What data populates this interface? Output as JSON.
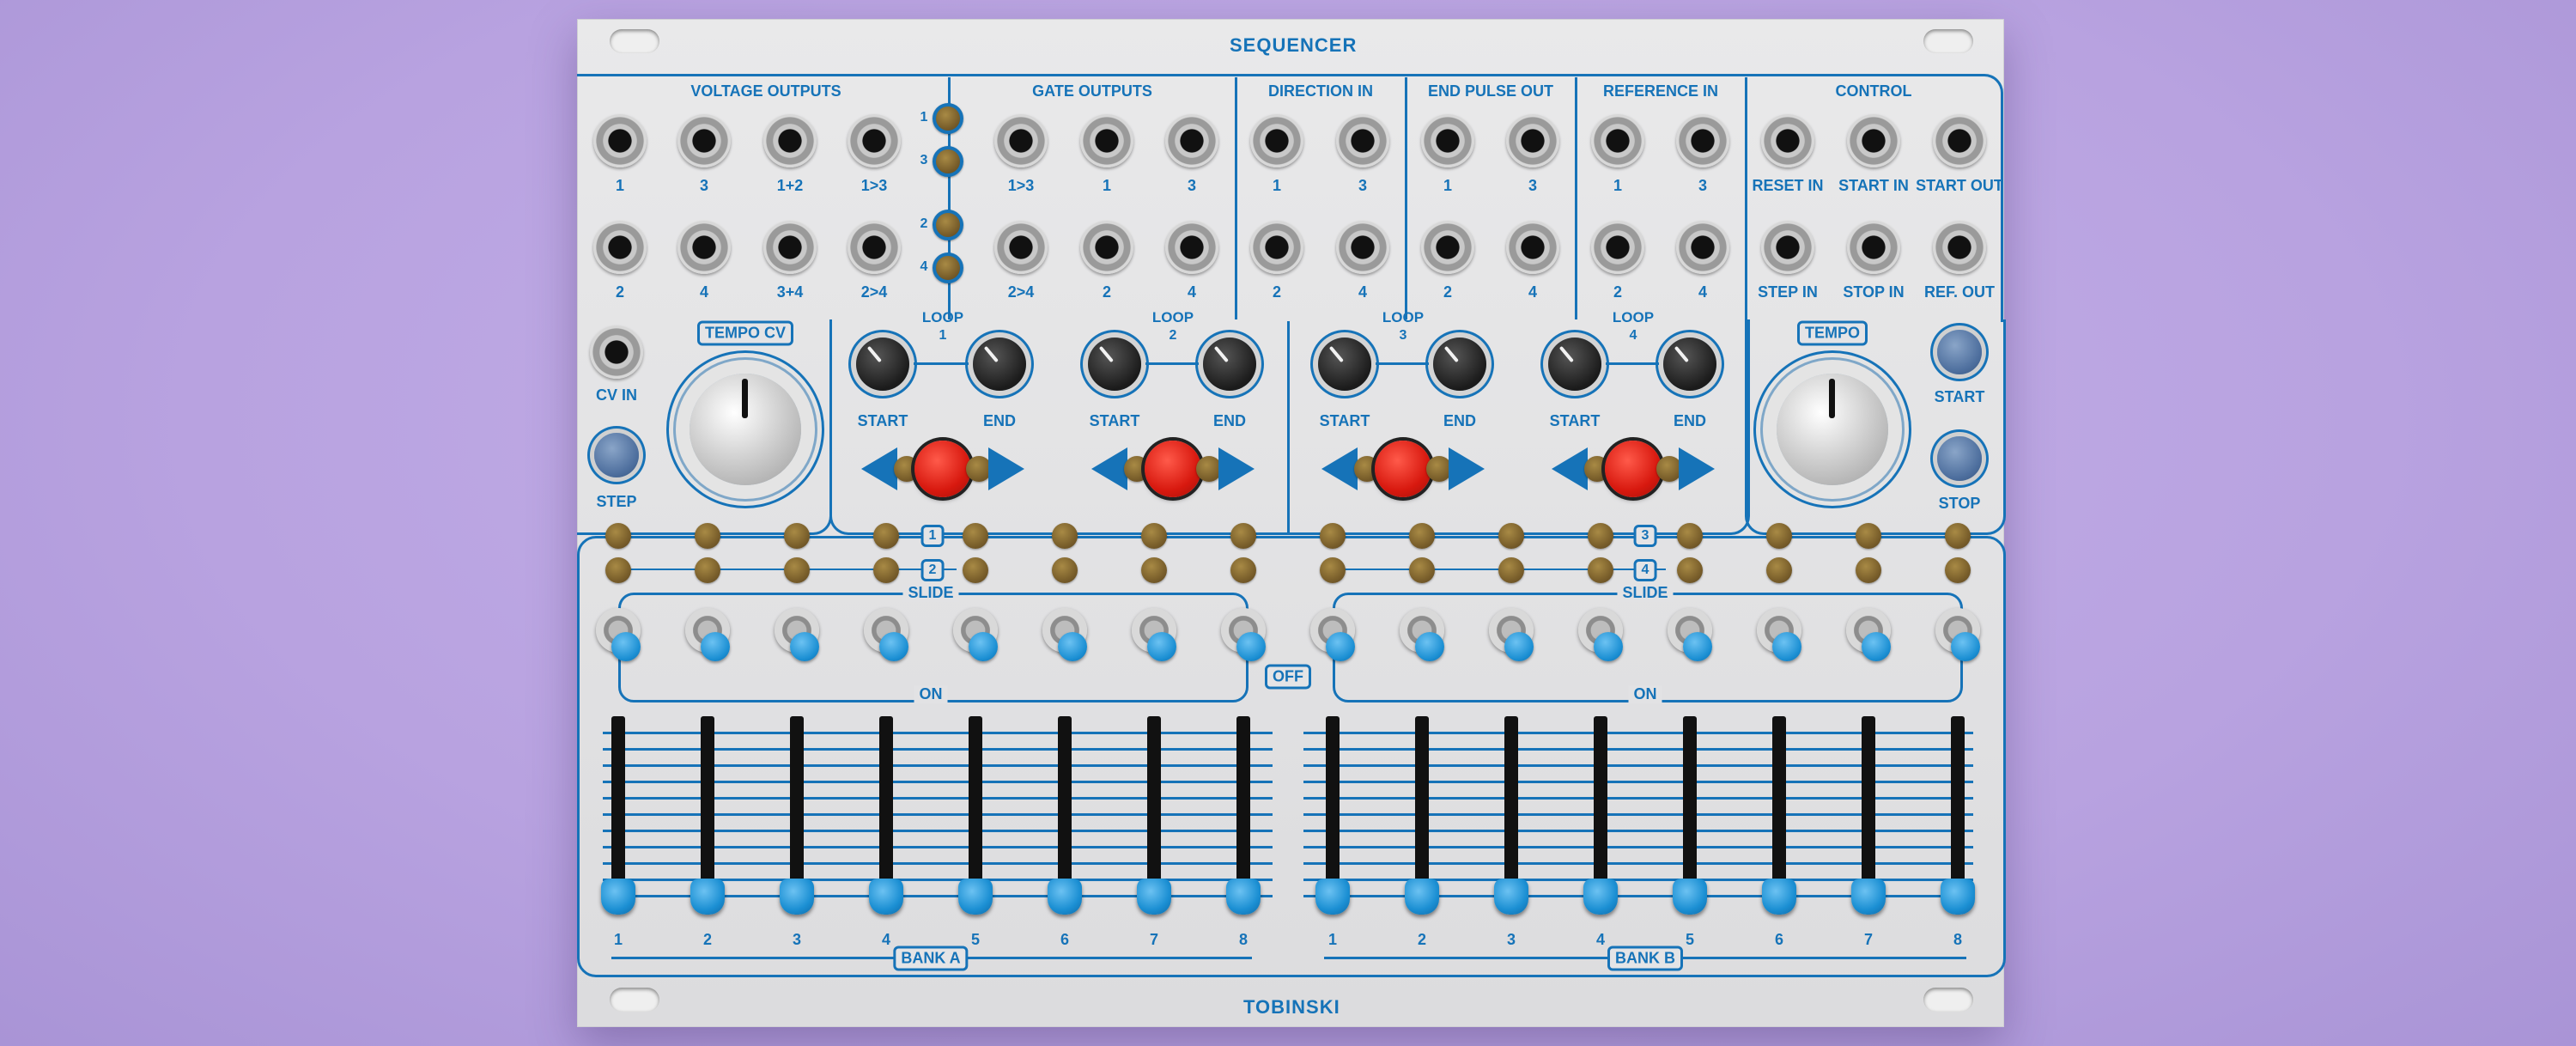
{
  "module": {
    "title": "SEQUENCER",
    "brand": "TOBINSKI"
  },
  "sections": {
    "voltage_outputs": "VOLTAGE OUTPUTS",
    "gate_outputs": "GATE OUTPUTS",
    "direction_in": "DIRECTION IN",
    "end_pulse_out": "END PULSE OUT",
    "reference_in": "REFERENCE IN",
    "control": "CONTROL"
  },
  "voltage_outputs": {
    "row1": [
      "1",
      "3",
      "1+2",
      "1>3"
    ],
    "row2": [
      "2",
      "4",
      "3+4",
      "2>4"
    ]
  },
  "gate_leds": [
    "1",
    "3",
    "2",
    "4"
  ],
  "gate_outputs": {
    "row1": [
      "1>3",
      "1",
      "3"
    ],
    "row2": [
      "2>4",
      "2",
      "4"
    ]
  },
  "direction_in": {
    "row1": [
      "1",
      "3"
    ],
    "row2": [
      "2",
      "4"
    ]
  },
  "end_pulse_out": {
    "row1": [
      "1",
      "3"
    ],
    "row2": [
      "2",
      "4"
    ]
  },
  "reference_in": {
    "row1": [
      "1",
      "3"
    ],
    "row2": [
      "2",
      "4"
    ]
  },
  "control": {
    "row1": [
      "RESET IN",
      "START IN",
      "START OUT"
    ],
    "row2": [
      "STEP IN",
      "STOP IN",
      "REF. OUT"
    ]
  },
  "tempo_cv": {
    "label": "TEMPO CV",
    "cv_in": "CV IN",
    "step": "STEP"
  },
  "loops": [
    {
      "label": "LOOP",
      "number": "1",
      "start": "START",
      "end": "END"
    },
    {
      "label": "LOOP",
      "number": "2",
      "start": "START",
      "end": "END"
    },
    {
      "label": "LOOP",
      "number": "3",
      "start": "START",
      "end": "END"
    },
    {
      "label": "LOOP",
      "number": "4",
      "start": "START",
      "end": "END"
    }
  ],
  "tempo": {
    "label": "TEMPO",
    "start": "START",
    "stop": "STOP"
  },
  "step_rows": {
    "bank_a": [
      "1",
      "2"
    ],
    "bank_b": [
      "3",
      "4"
    ]
  },
  "switches": {
    "slide": "SLIDE",
    "on": "ON",
    "off": "OFF"
  },
  "banks": {
    "a": {
      "label": "BANK A",
      "steps": [
        "1",
        "2",
        "3",
        "4",
        "5",
        "6",
        "7",
        "8"
      ]
    },
    "b": {
      "label": "BANK B",
      "steps": [
        "1",
        "2",
        "3",
        "4",
        "5",
        "6",
        "7",
        "8"
      ]
    }
  },
  "colors": {
    "panel": "#e3e3e5",
    "print": "#1673b8",
    "background": "#b8a2e0",
    "button_red": "#d8190f",
    "cap_blue": "#1b8fd3"
  }
}
